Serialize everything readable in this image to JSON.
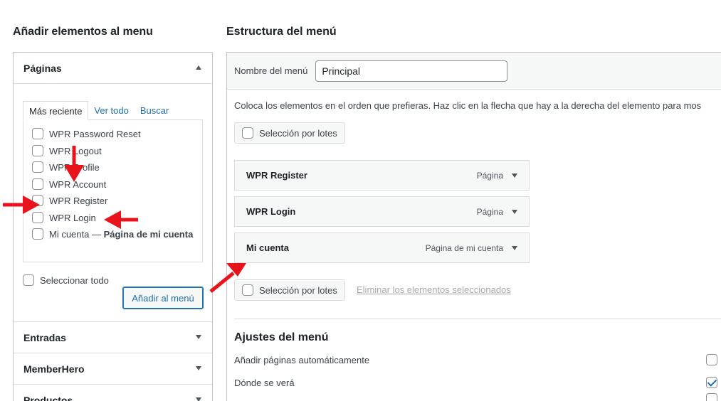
{
  "left_panel": {
    "title": "Añadir elementos al menu",
    "sections": [
      {
        "label": "Páginas",
        "expanded": true
      },
      {
        "label": "Entradas",
        "expanded": false
      },
      {
        "label": "MemberHero",
        "expanded": false
      },
      {
        "label": "Productos",
        "expanded": false
      }
    ],
    "tabs": [
      "Más reciente",
      "Ver todo",
      "Buscar"
    ],
    "active_tab": "Más reciente",
    "pages": [
      {
        "label": "WPR Password Reset",
        "checked": false
      },
      {
        "label": "WPR Logout",
        "checked": false
      },
      {
        "label": "WPR Profile",
        "checked": false
      },
      {
        "label": "WPR Account",
        "checked": false
      },
      {
        "label": "WPR Register",
        "checked": false
      },
      {
        "label": "WPR Login",
        "checked": false
      },
      {
        "label": "Mi cuenta — ",
        "label_strong": "Página de mi cuenta",
        "checked": false
      }
    ],
    "select_all_label": "Seleccionar todo",
    "add_button_label": "Añadir al menú"
  },
  "right_panel": {
    "title": "Estructura del menú",
    "menu_name_label": "Nombre del menú",
    "menu_name_value": "Principal",
    "instructions": "Coloca los elementos en el orden que prefieras. Haz clic en la flecha que hay a la derecha del elemento para mos",
    "bulk_select_label": "Selección por lotes",
    "menu_items": [
      {
        "title": "WPR Register",
        "type": "Página"
      },
      {
        "title": "WPR Login",
        "type": "Página"
      },
      {
        "title": "Mi cuenta",
        "type": "Página de mi cuenta"
      }
    ],
    "remove_selected_label": "Eliminar los elementos seleccionados",
    "settings_title": "Ajustes del menú",
    "settings": [
      {
        "label": "Añadir páginas automáticamente",
        "checked": false
      },
      {
        "label": "Dónde se verá",
        "checked": true
      },
      {
        "label": "",
        "checked": false
      }
    ]
  },
  "colors": {
    "annotation_arrow": "#e8141c",
    "link_blue": "#2271b1",
    "border": "#c3c4c7"
  },
  "icons": [
    "collapse-up-icon",
    "expand-down-icon",
    "checkbox-icon",
    "annotation-arrow-icon"
  ]
}
